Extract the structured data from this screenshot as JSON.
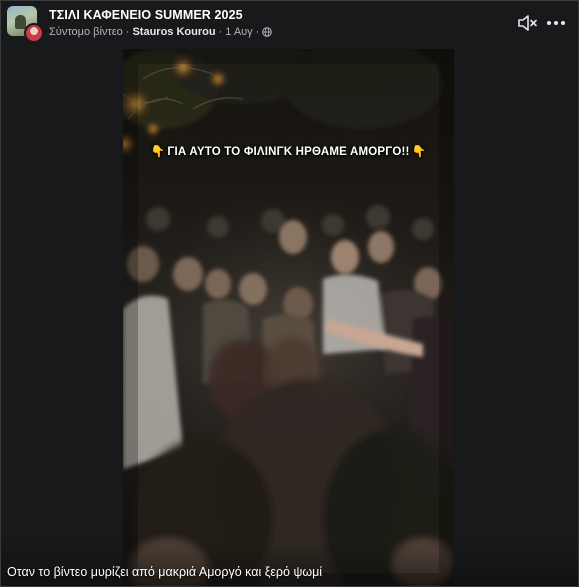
{
  "header": {
    "page_name": "ΤΣΙΛΙ ΚΑΦΕΝΕΙΟ SUMMER 2025",
    "post_type": "Σύντομο βίντεο",
    "separator": "·",
    "author": "Stauros Kourou",
    "date": "1 Αυγ",
    "privacy_icon": "globe-icon",
    "controls": {
      "mute_icon": "speaker-muted-icon",
      "more_icon": "more-horizontal-icon"
    }
  },
  "video": {
    "overlay_caption": "ΓΙΑ ΑΥΤΟ ΤΟ ΦΙΛΙΝΓΚ ΗΡΘΑΜΕ ΑΜΟΡΓΟ!!",
    "caption_emoji": "👇"
  },
  "post": {
    "description": "Οταν το βίντεο μυρίζει από μακριά Αμοργό και ξερό ψωμί"
  },
  "colors": {
    "background": "#18191a",
    "text_primary": "#ffffff",
    "text_secondary": "#b0b3b8"
  }
}
